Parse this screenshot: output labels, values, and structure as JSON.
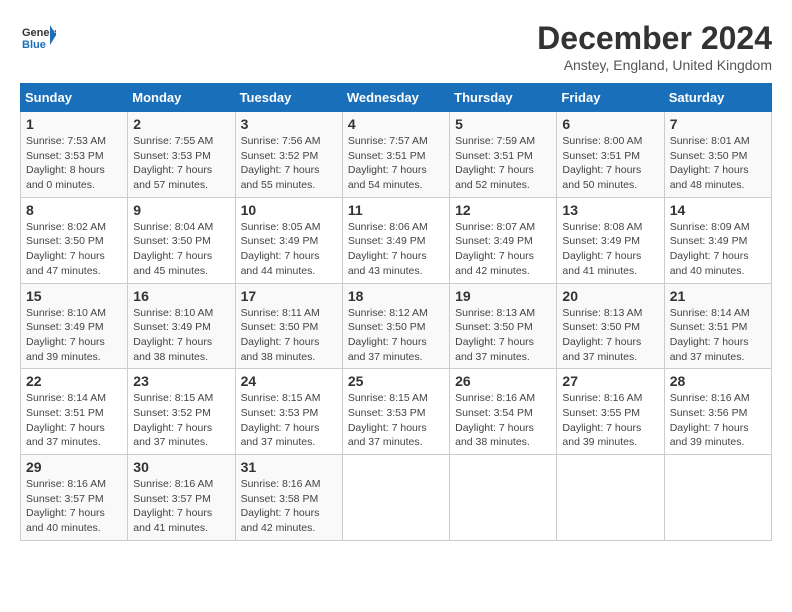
{
  "header": {
    "logo_general": "General",
    "logo_blue": "Blue",
    "month_title": "December 2024",
    "location": "Anstey, England, United Kingdom"
  },
  "weekdays": [
    "Sunday",
    "Monday",
    "Tuesday",
    "Wednesday",
    "Thursday",
    "Friday",
    "Saturday"
  ],
  "weeks": [
    [
      {
        "day": "1",
        "sunrise": "Sunrise: 7:53 AM",
        "sunset": "Sunset: 3:53 PM",
        "daylight": "Daylight: 8 hours and 0 minutes."
      },
      {
        "day": "2",
        "sunrise": "Sunrise: 7:55 AM",
        "sunset": "Sunset: 3:53 PM",
        "daylight": "Daylight: 7 hours and 57 minutes."
      },
      {
        "day": "3",
        "sunrise": "Sunrise: 7:56 AM",
        "sunset": "Sunset: 3:52 PM",
        "daylight": "Daylight: 7 hours and 55 minutes."
      },
      {
        "day": "4",
        "sunrise": "Sunrise: 7:57 AM",
        "sunset": "Sunset: 3:51 PM",
        "daylight": "Daylight: 7 hours and 54 minutes."
      },
      {
        "day": "5",
        "sunrise": "Sunrise: 7:59 AM",
        "sunset": "Sunset: 3:51 PM",
        "daylight": "Daylight: 7 hours and 52 minutes."
      },
      {
        "day": "6",
        "sunrise": "Sunrise: 8:00 AM",
        "sunset": "Sunset: 3:51 PM",
        "daylight": "Daylight: 7 hours and 50 minutes."
      },
      {
        "day": "7",
        "sunrise": "Sunrise: 8:01 AM",
        "sunset": "Sunset: 3:50 PM",
        "daylight": "Daylight: 7 hours and 48 minutes."
      }
    ],
    [
      {
        "day": "8",
        "sunrise": "Sunrise: 8:02 AM",
        "sunset": "Sunset: 3:50 PM",
        "daylight": "Daylight: 7 hours and 47 minutes."
      },
      {
        "day": "9",
        "sunrise": "Sunrise: 8:04 AM",
        "sunset": "Sunset: 3:50 PM",
        "daylight": "Daylight: 7 hours and 45 minutes."
      },
      {
        "day": "10",
        "sunrise": "Sunrise: 8:05 AM",
        "sunset": "Sunset: 3:49 PM",
        "daylight": "Daylight: 7 hours and 44 minutes."
      },
      {
        "day": "11",
        "sunrise": "Sunrise: 8:06 AM",
        "sunset": "Sunset: 3:49 PM",
        "daylight": "Daylight: 7 hours and 43 minutes."
      },
      {
        "day": "12",
        "sunrise": "Sunrise: 8:07 AM",
        "sunset": "Sunset: 3:49 PM",
        "daylight": "Daylight: 7 hours and 42 minutes."
      },
      {
        "day": "13",
        "sunrise": "Sunrise: 8:08 AM",
        "sunset": "Sunset: 3:49 PM",
        "daylight": "Daylight: 7 hours and 41 minutes."
      },
      {
        "day": "14",
        "sunrise": "Sunrise: 8:09 AM",
        "sunset": "Sunset: 3:49 PM",
        "daylight": "Daylight: 7 hours and 40 minutes."
      }
    ],
    [
      {
        "day": "15",
        "sunrise": "Sunrise: 8:10 AM",
        "sunset": "Sunset: 3:49 PM",
        "daylight": "Daylight: 7 hours and 39 minutes."
      },
      {
        "day": "16",
        "sunrise": "Sunrise: 8:10 AM",
        "sunset": "Sunset: 3:49 PM",
        "daylight": "Daylight: 7 hours and 38 minutes."
      },
      {
        "day": "17",
        "sunrise": "Sunrise: 8:11 AM",
        "sunset": "Sunset: 3:50 PM",
        "daylight": "Daylight: 7 hours and 38 minutes."
      },
      {
        "day": "18",
        "sunrise": "Sunrise: 8:12 AM",
        "sunset": "Sunset: 3:50 PM",
        "daylight": "Daylight: 7 hours and 37 minutes."
      },
      {
        "day": "19",
        "sunrise": "Sunrise: 8:13 AM",
        "sunset": "Sunset: 3:50 PM",
        "daylight": "Daylight: 7 hours and 37 minutes."
      },
      {
        "day": "20",
        "sunrise": "Sunrise: 8:13 AM",
        "sunset": "Sunset: 3:50 PM",
        "daylight": "Daylight: 7 hours and 37 minutes."
      },
      {
        "day": "21",
        "sunrise": "Sunrise: 8:14 AM",
        "sunset": "Sunset: 3:51 PM",
        "daylight": "Daylight: 7 hours and 37 minutes."
      }
    ],
    [
      {
        "day": "22",
        "sunrise": "Sunrise: 8:14 AM",
        "sunset": "Sunset: 3:51 PM",
        "daylight": "Daylight: 7 hours and 37 minutes."
      },
      {
        "day": "23",
        "sunrise": "Sunrise: 8:15 AM",
        "sunset": "Sunset: 3:52 PM",
        "daylight": "Daylight: 7 hours and 37 minutes."
      },
      {
        "day": "24",
        "sunrise": "Sunrise: 8:15 AM",
        "sunset": "Sunset: 3:53 PM",
        "daylight": "Daylight: 7 hours and 37 minutes."
      },
      {
        "day": "25",
        "sunrise": "Sunrise: 8:15 AM",
        "sunset": "Sunset: 3:53 PM",
        "daylight": "Daylight: 7 hours and 37 minutes."
      },
      {
        "day": "26",
        "sunrise": "Sunrise: 8:16 AM",
        "sunset": "Sunset: 3:54 PM",
        "daylight": "Daylight: 7 hours and 38 minutes."
      },
      {
        "day": "27",
        "sunrise": "Sunrise: 8:16 AM",
        "sunset": "Sunset: 3:55 PM",
        "daylight": "Daylight: 7 hours and 39 minutes."
      },
      {
        "day": "28",
        "sunrise": "Sunrise: 8:16 AM",
        "sunset": "Sunset: 3:56 PM",
        "daylight": "Daylight: 7 hours and 39 minutes."
      }
    ],
    [
      {
        "day": "29",
        "sunrise": "Sunrise: 8:16 AM",
        "sunset": "Sunset: 3:57 PM",
        "daylight": "Daylight: 7 hours and 40 minutes."
      },
      {
        "day": "30",
        "sunrise": "Sunrise: 8:16 AM",
        "sunset": "Sunset: 3:57 PM",
        "daylight": "Daylight: 7 hours and 41 minutes."
      },
      {
        "day": "31",
        "sunrise": "Sunrise: 8:16 AM",
        "sunset": "Sunset: 3:58 PM",
        "daylight": "Daylight: 7 hours and 42 minutes."
      },
      null,
      null,
      null,
      null
    ]
  ]
}
